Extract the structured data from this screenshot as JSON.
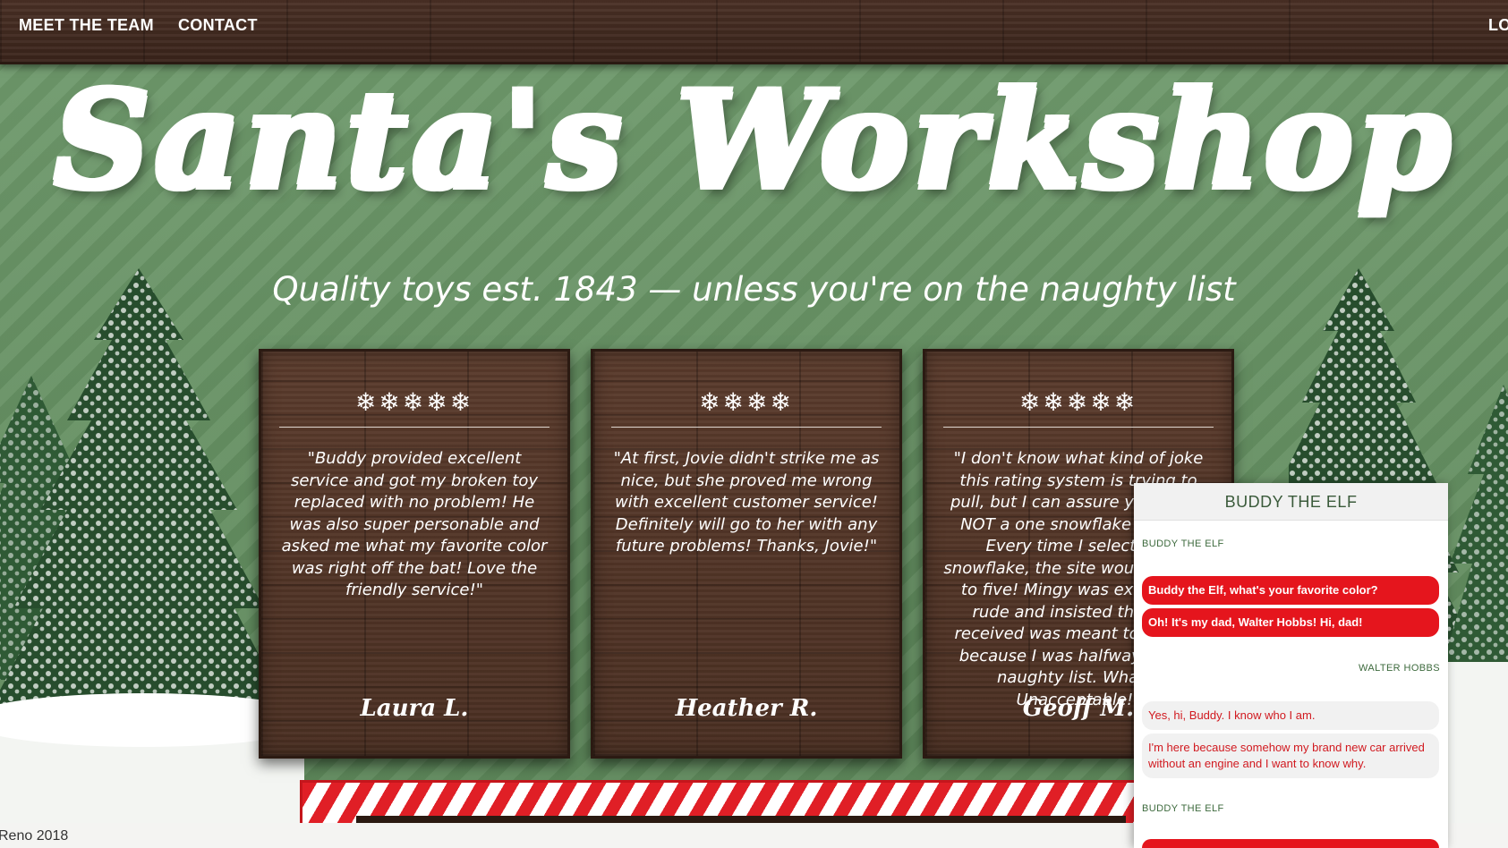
{
  "nav": {
    "team": "MEET THE TEAM",
    "contact": "CONTACT",
    "login": "LO"
  },
  "hero": {
    "title_a": "Santa's",
    "title_b": "Workshop",
    "tagline": "Quality toys est. 1843 — unless you're on the naughty list"
  },
  "reviews": [
    {
      "rating": "❄❄❄❄❄",
      "text": "\"Buddy provided excellent service and got my broken toy replaced with no problem! He was also super personable and asked me what my favorite color was right off the bat! Love the friendly service!\"",
      "author": "Laura L."
    },
    {
      "rating": "❄❄❄❄",
      "text": "\"At first, Jovie didn't strike me as nice, but she proved me wrong with excellent customer service! Definitely will go to her with any future problems! Thanks, Jovie!\"",
      "author": "Heather R."
    },
    {
      "rating": "❄❄❄❄❄",
      "text": "\"I don't know what kind of joke this rating system is trying to pull, but I can assure you this is NOT a one snowflake review! Every time I select one snowflake, the site would change to five! Mingy was extremely rude and insisted the toy I received was meant to be coal because I was halfway on the naughty list. What?! Unacceptable!\"",
      "author": "Geoff M."
    }
  ],
  "footer": {
    "text": "Reno 2018"
  },
  "chat": {
    "header": "BUDDY THE ELF",
    "sender_buddy": "BUDDY THE ELF",
    "sender_walter": "WALTER HOBBS",
    "msg1": "Buddy the Elf, what's your favorite color?",
    "msg2": "Oh! It's my dad, Walter Hobbs! Hi, dad!",
    "msg3": "Yes, hi, Buddy. I know who I am.",
    "msg4": "I'm here because somehow my brand new car arrived without an engine and I want to know why.",
    "sender_buddy2": "BUDDY THE ELF"
  },
  "colors": {
    "candy_red": "#e01f26",
    "pine_green": "#2f5a35",
    "wood": "#4a2f22"
  }
}
